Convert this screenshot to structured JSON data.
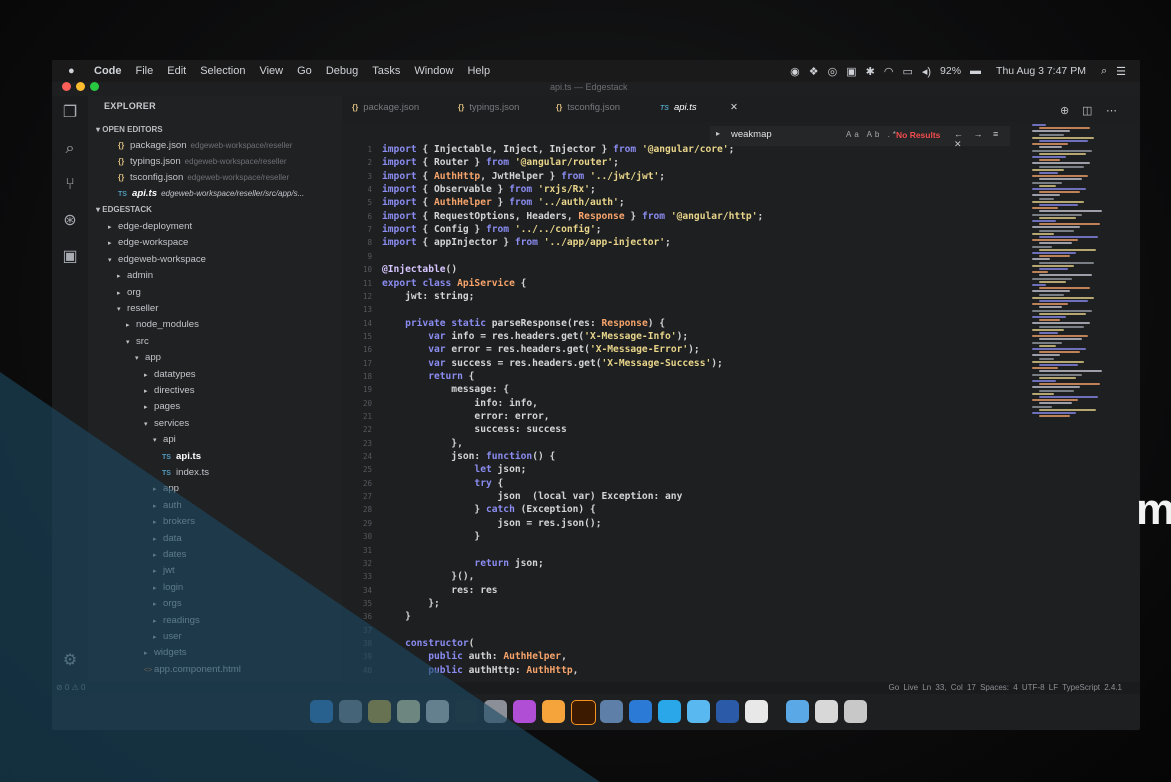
{
  "menubar": {
    "app": "Code",
    "items": [
      "File",
      "Edit",
      "Selection",
      "View",
      "Go",
      "Debug",
      "Tasks",
      "Window",
      "Help"
    ],
    "battery": "92%",
    "clock": "Thu Aug 3  7:47 PM"
  },
  "window_title": "api.ts — Edgestack",
  "sidebar": {
    "title": "EXPLORER",
    "open_editors_label": "OPEN EDITORS",
    "open_editors": [
      {
        "icon": "{}",
        "name": "package.json",
        "path": "edgeweb-workspace/reseller"
      },
      {
        "icon": "{}",
        "name": "typings.json",
        "path": "edgeweb-workspace/reseller"
      },
      {
        "icon": "{}",
        "name": "tsconfig.json",
        "path": "edgeweb-workspace/reseller"
      },
      {
        "icon": "TS",
        "name": "api.ts",
        "path": "edgeweb-workspace/reseller/src/app/s..."
      }
    ],
    "project_label": "EDGESTACK",
    "tree": [
      {
        "name": "edge-deployment",
        "depth": 0,
        "arrow": "▸"
      },
      {
        "name": "edge-workspace",
        "depth": 0,
        "arrow": "▸"
      },
      {
        "name": "edgeweb-workspace",
        "depth": 0,
        "arrow": "▾"
      },
      {
        "name": "admin",
        "depth": 1,
        "arrow": "▸"
      },
      {
        "name": "org",
        "depth": 1,
        "arrow": "▸"
      },
      {
        "name": "reseller",
        "depth": 1,
        "arrow": "▾"
      },
      {
        "name": "node_modules",
        "depth": 2,
        "arrow": "▸"
      },
      {
        "name": "src",
        "depth": 2,
        "arrow": "▾"
      },
      {
        "name": "app",
        "depth": 3,
        "arrow": "▾"
      },
      {
        "name": "datatypes",
        "depth": 4,
        "arrow": "▸"
      },
      {
        "name": "directives",
        "depth": 4,
        "arrow": "▸"
      },
      {
        "name": "pages",
        "depth": 4,
        "arrow": "▸"
      },
      {
        "name": "services",
        "depth": 4,
        "arrow": "▾"
      },
      {
        "name": "api",
        "depth": 5,
        "arrow": "▾"
      },
      {
        "name": "api.ts",
        "depth": 6,
        "arrow": "TS"
      },
      {
        "name": "index.ts",
        "depth": 6,
        "arrow": "TS"
      },
      {
        "name": "app",
        "depth": 5,
        "arrow": "▸"
      },
      {
        "name": "auth",
        "depth": 5,
        "arrow": "▸"
      },
      {
        "name": "brokers",
        "depth": 5,
        "arrow": "▸"
      },
      {
        "name": "data",
        "depth": 5,
        "arrow": "▸"
      },
      {
        "name": "dates",
        "depth": 5,
        "arrow": "▸"
      },
      {
        "name": "jwt",
        "depth": 5,
        "arrow": "▸"
      },
      {
        "name": "login",
        "depth": 5,
        "arrow": "▸"
      },
      {
        "name": "orgs",
        "depth": 5,
        "arrow": "▸"
      },
      {
        "name": "readings",
        "depth": 5,
        "arrow": "▸"
      },
      {
        "name": "user",
        "depth": 5,
        "arrow": "▸"
      },
      {
        "name": "widgets",
        "depth": 4,
        "arrow": "▸"
      },
      {
        "name": "app.component.html",
        "depth": 4,
        "arrow": "<>"
      }
    ]
  },
  "tabs": [
    {
      "icon": "{}",
      "label": "package.json"
    },
    {
      "icon": "{}",
      "label": "typings.json"
    },
    {
      "icon": "{}",
      "label": "tsconfig.json"
    },
    {
      "icon": "TS",
      "label": "api.ts",
      "active": true
    }
  ],
  "find": {
    "term": "weakmap",
    "options": "Aa Ab .*",
    "result": "No Results"
  },
  "code": {
    "lines": [
      {
        "n": "1",
        "t": "import { Injectable, Inject, Injector } from '@angular/core';"
      },
      {
        "n": "2",
        "t": "import { Router } from '@angular/router';"
      },
      {
        "n": "3",
        "t": "import { AuthHttp, JwtHelper } from '../jwt/jwt';"
      },
      {
        "n": "4",
        "t": "import { Observable } from 'rxjs/Rx';"
      },
      {
        "n": "5",
        "t": "import { AuthHelper } from '../auth/auth';"
      },
      {
        "n": "6",
        "t": "import { RequestOptions, Headers, Response } from '@angular/http';"
      },
      {
        "n": "7",
        "t": "import { Config } from '../../config';"
      },
      {
        "n": "8",
        "t": "import { appInjector } from '../app/app-injector';"
      },
      {
        "n": "9",
        "t": ""
      },
      {
        "n": "10",
        "t": "@Injectable()"
      },
      {
        "n": "11",
        "t": "export class ApiService {"
      },
      {
        "n": "12",
        "t": "    jwt: string;"
      },
      {
        "n": "13",
        "t": ""
      },
      {
        "n": "14",
        "t": "    private static parseResponse(res: Response) {"
      },
      {
        "n": "15",
        "t": "        var info = res.headers.get('X-Message-Info');"
      },
      {
        "n": "16",
        "t": "        var error = res.headers.get('X-Message-Error');"
      },
      {
        "n": "17",
        "t": "        var success = res.headers.get('X-Message-Success');"
      },
      {
        "n": "18",
        "t": "        return {"
      },
      {
        "n": "19",
        "t": "            message: {"
      },
      {
        "n": "20",
        "t": "                info: info,"
      },
      {
        "n": "21",
        "t": "                error: error,"
      },
      {
        "n": "22",
        "t": "                success: success"
      },
      {
        "n": "23",
        "t": "            },"
      },
      {
        "n": "24",
        "t": "            json: function() {"
      },
      {
        "n": "25",
        "t": "                let json;"
      },
      {
        "n": "26",
        "t": "                try {"
      },
      {
        "n": "27",
        "t": "                    json  (local var) Exception: any"
      },
      {
        "n": "28",
        "t": "                } catch (Exception) {"
      },
      {
        "n": "29",
        "t": "                    json = res.json();"
      },
      {
        "n": "30",
        "t": "                }"
      },
      {
        "n": "31",
        "t": ""
      },
      {
        "n": "32",
        "t": "                return json;"
      },
      {
        "n": "33",
        "t": "            }(),"
      },
      {
        "n": "34",
        "t": "            res: res"
      },
      {
        "n": "35",
        "t": "        };"
      },
      {
        "n": "36",
        "t": "    }"
      },
      {
        "n": "37",
        "t": ""
      },
      {
        "n": "38",
        "t": "    constructor("
      },
      {
        "n": "39",
        "t": "        public auth: AuthHelper,"
      },
      {
        "n": "40",
        "t": "        public authHttp: AuthHttp,"
      }
    ]
  },
  "status": {
    "left": "⊘ 0  ⚠ 0",
    "right": "Go Live   Ln 33, Col 17   Spaces: 4   UTF-8   LF   TypeScript  2.4.1"
  },
  "brand_letter": "m",
  "colors": {
    "keyword": "#8a8cf0",
    "string": "#e8d58a",
    "class": "#f6a46b",
    "error": "#f14c4c",
    "overlay": "#1d4a63"
  }
}
